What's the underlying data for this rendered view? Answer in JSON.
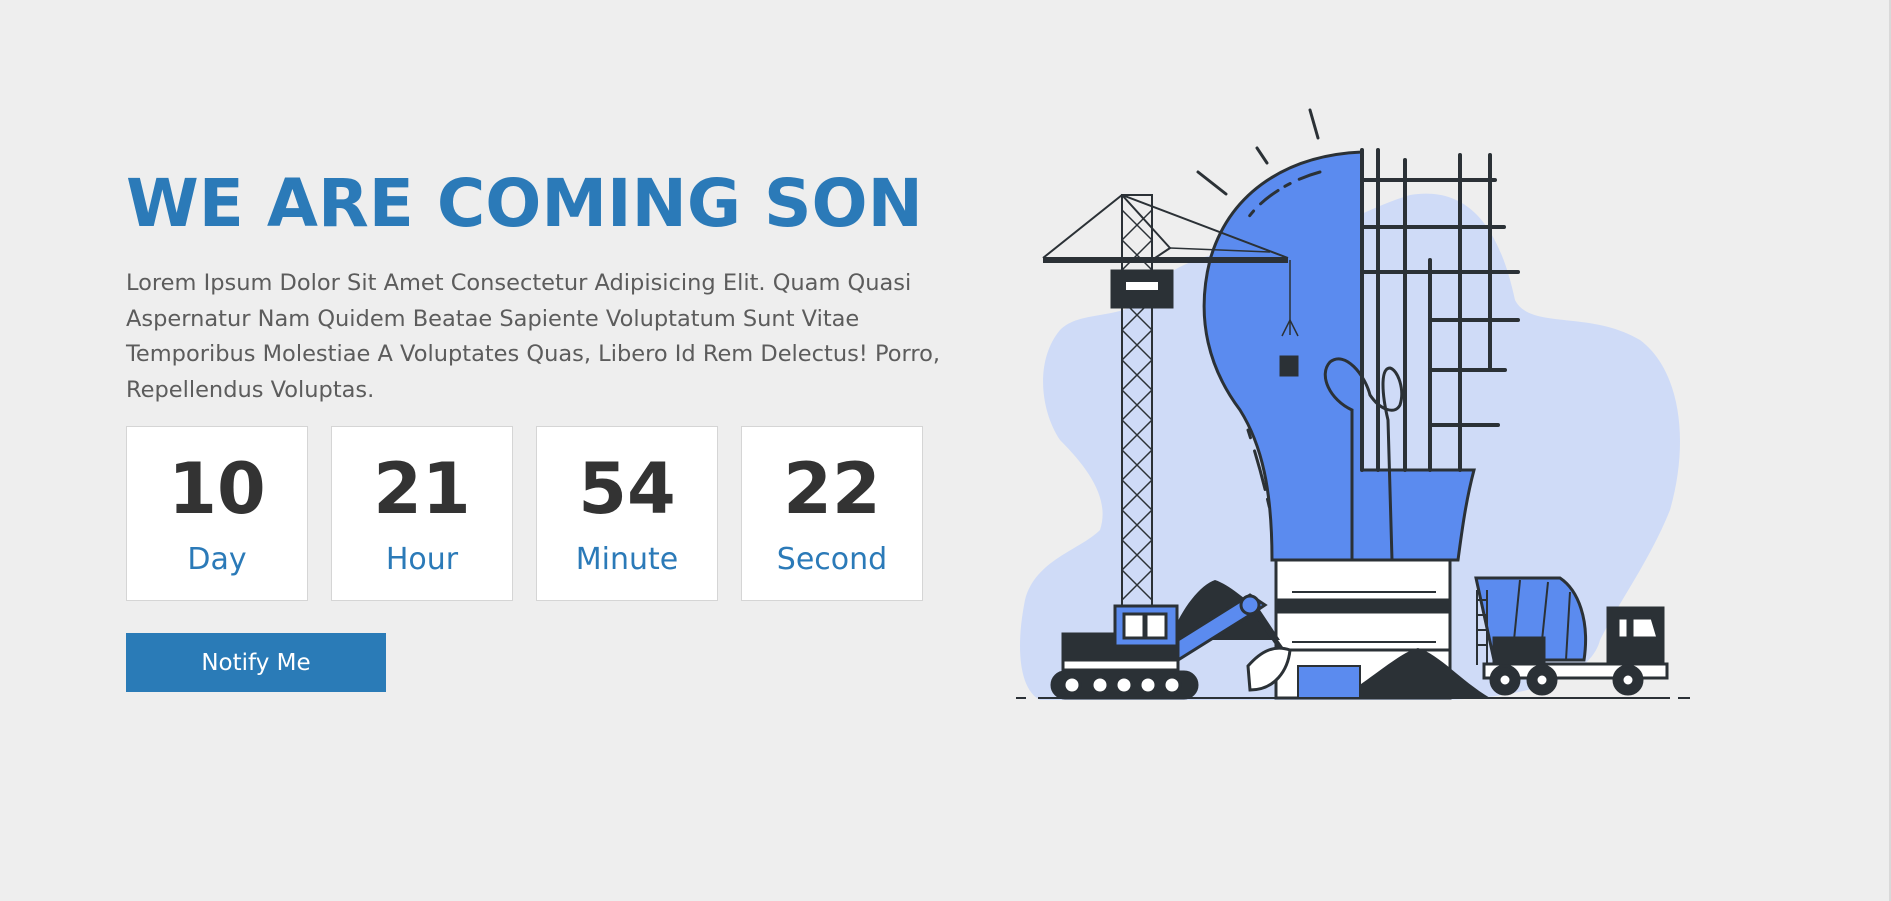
{
  "hero": {
    "title": "WE ARE COMING SON",
    "description": "Lorem Ipsum Dolor Sit Amet Consectetur Adipisicing Elit. Quam Quasi Aspernatur Nam Quidem Beatae Sapiente Voluptatum Sunt Vitae Temporibus Molestiae A Voluptates Quas, Libero Id Rem Delectus! Porro, Repellendus Voluptas."
  },
  "countdown": [
    {
      "value": "10",
      "label": "Day"
    },
    {
      "value": "21",
      "label": "Hour"
    },
    {
      "value": "54",
      "label": "Minute"
    },
    {
      "value": "22",
      "label": "Second"
    }
  ],
  "notify_button": {
    "label": "Notify Me"
  },
  "colors": {
    "accent": "#2b7ab8",
    "background": "#eeeeee",
    "illustration_blue": "#5b8bef",
    "illustration_light": "#cfdbf7",
    "illustration_dark": "#2b3136"
  },
  "illustration": {
    "name": "construction-lightbulb-illustration"
  }
}
